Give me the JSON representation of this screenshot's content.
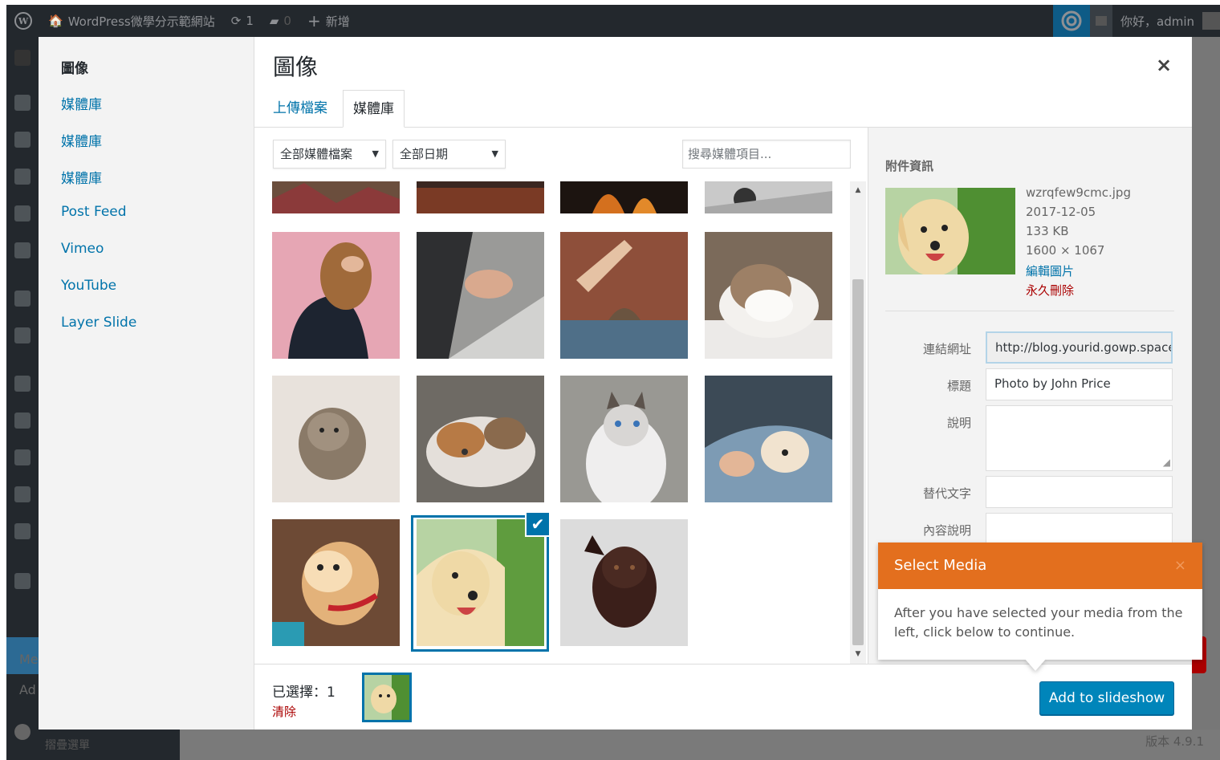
{
  "admin_bar": {
    "site_name": "WordPress微學分示範網站",
    "updates_count": "1",
    "comments_count": "0",
    "new_label": "新增",
    "greeting": "你好，admin"
  },
  "admin_menu": {
    "collapsed_text_1": "Me",
    "collapsed_text_2": "Ad",
    "collapse_label": "摺疊選單"
  },
  "footer": {
    "version": "版本 4.9.1"
  },
  "modal": {
    "menu": {
      "heading": "圖像",
      "items": [
        "媒體庫",
        "媒體庫",
        "媒體庫",
        "Post Feed",
        "Vimeo",
        "YouTube",
        "Layer Slide"
      ]
    },
    "title": "圖像",
    "close_icon": "×",
    "tabs": [
      {
        "label": "上傳檔案"
      },
      {
        "label": "媒體庫"
      }
    ],
    "filters": {
      "type": "全部媒體檔案",
      "date": "全部日期",
      "search_placeholder": "搜尋媒體項目..."
    },
    "check_mark": "✔",
    "attachment": {
      "heading": "附件資訊",
      "filename": "wzrqfew9cmc.jpg",
      "date": "2017-12-05",
      "size": "133 KB",
      "dimensions": "1600 × 1067",
      "edit_link": "編輯圖片",
      "delete_link": "永久刪除",
      "fields": {
        "url_label": "連結網址",
        "url_value": "http://blog.yourid.gowp.space",
        "title_label": "標題",
        "title_value": "Photo by John Price",
        "caption_label": "說明",
        "alt_label": "替代文字",
        "description_label": "內容說明"
      }
    },
    "selection": {
      "count_label": "已選擇：1",
      "clear_label": "清除"
    },
    "primary_button": "Add to slideshow"
  },
  "pointer": {
    "title": "Select Media",
    "close": "×",
    "body": "After you have selected your media from the left, click below to continue."
  }
}
